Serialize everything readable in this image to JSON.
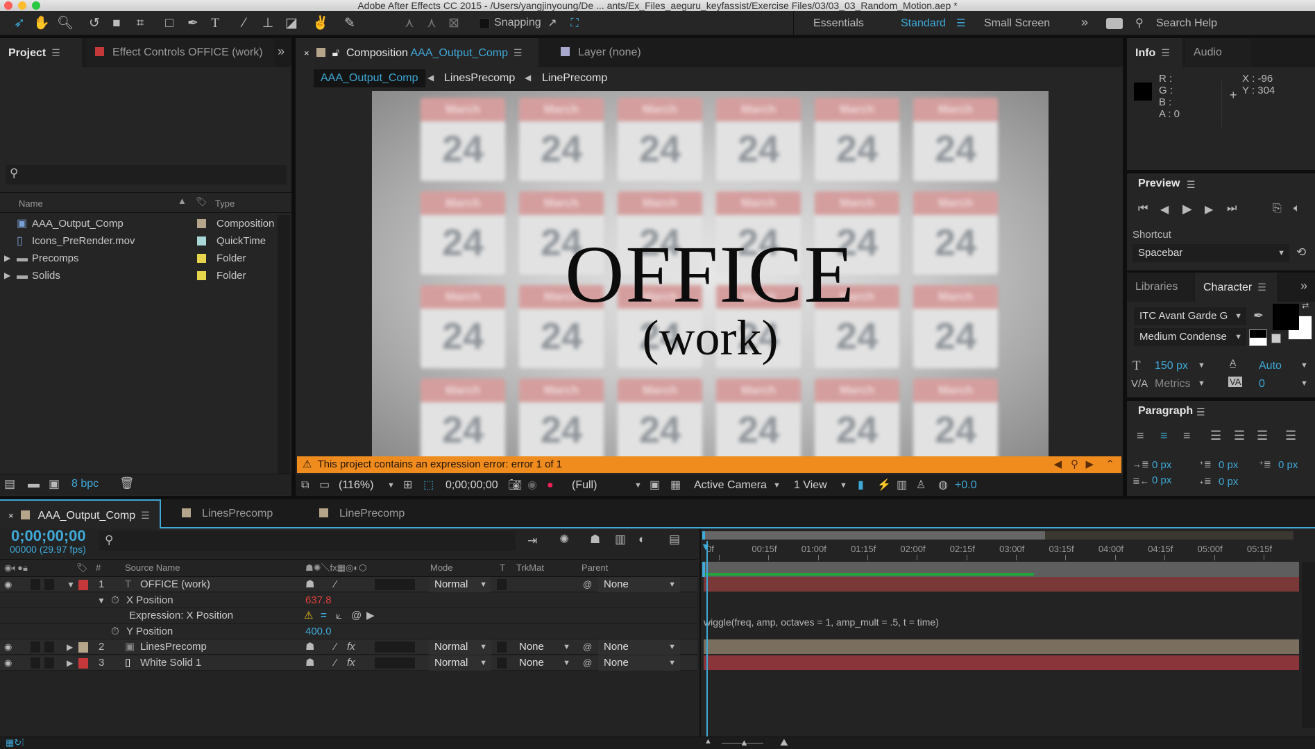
{
  "window": {
    "title": "Adobe After Effects CC 2015 - /Users/yangjinyoung/De ... ants/Ex_Files_aeguru_keyfassist/Exercise Files/03/03_03_Random_Motion.aep *"
  },
  "toolbar": {
    "tools": [
      "selection-tool",
      "hand-tool",
      "zoom-tool",
      "rotation-tool",
      "camera-tool",
      "pan-behind-tool",
      "rectangle-tool",
      "pen-tool",
      "type-tool",
      "brush-tool",
      "clone-stamp-tool",
      "eraser-tool",
      "roto-brush-tool",
      "puppet-pin-tool"
    ],
    "snapping_label": "Snapping",
    "workspaces": [
      "Essentials",
      "Standard",
      "Small Screen"
    ],
    "active_workspace": "Standard",
    "search_placeholder": "Search Help"
  },
  "project_panel": {
    "tab_project": "Project",
    "tab_effect_controls": "Effect Controls OFFICE (work)",
    "search_placeholder": "",
    "columns": {
      "name": "Name",
      "type": "Type"
    },
    "items": [
      {
        "name": "AAA_Output_Comp",
        "type": "Composition",
        "label_color": "#b5a58a",
        "icon": "composition-icon"
      },
      {
        "name": "Icons_PreRender.mov",
        "type": "QuickTime",
        "label_color": "#a9d7d8",
        "icon": "footage-icon"
      },
      {
        "name": "Precomps",
        "type": "Folder",
        "label_color": "#e7d64c",
        "icon": "folder-icon"
      },
      {
        "name": "Solids",
        "type": "Folder",
        "label_color": "#e7d64c",
        "icon": "folder-icon"
      }
    ],
    "bpc": "8 bpc"
  },
  "composition_panel": {
    "tab_prefix": "Composition",
    "tab_comp_name": "AAA_Output_Comp",
    "tab_layer": "Layer (none)",
    "breadcrumbs": [
      "AAA_Output_Comp",
      "LinesPrecomp",
      "LinePrecomp"
    ],
    "viewer": {
      "tile_month": "March",
      "tile_day": "24",
      "headline": "OFFICE",
      "subline": "(work)"
    },
    "error_banner": "This project contains an expression error: error 1 of 1",
    "footer": {
      "zoom": "(116%)",
      "timecode": "0;00;00;00",
      "resolution": "(Full)",
      "camera": "Active Camera",
      "views": "1 View",
      "exposure": "+0.0"
    }
  },
  "info_panel": {
    "tab_info": "Info",
    "tab_audio": "Audio",
    "r": "R :",
    "g": "G :",
    "b": "B :",
    "a": "A : 0",
    "x": "X : -96",
    "y": "Y : 304"
  },
  "preview_panel": {
    "title": "Preview",
    "shortcut_label": "Shortcut",
    "shortcut_value": "Spacebar"
  },
  "character_panel": {
    "tab_libraries": "Libraries",
    "tab_character": "Character",
    "font_family": "ITC Avant Garde G",
    "font_style": "Medium Condense",
    "font_size": "150 px",
    "leading": "Auto",
    "kerning": "Metrics",
    "tracking": "0"
  },
  "paragraph_panel": {
    "title": "Paragraph",
    "indent_left": "0 px",
    "indent_right": "0 px",
    "first_line": "0 px",
    "space_before": "0 px",
    "space_after": "0 px"
  },
  "timeline": {
    "tabs": [
      {
        "label": "AAA_Output_Comp",
        "color": "#b5a58a",
        "active": true
      },
      {
        "label": "LinesPrecomp",
        "color": "#b5a58a",
        "active": false
      },
      {
        "label": "LinePrecomp",
        "color": "#b5a58a",
        "active": false
      }
    ],
    "current_time": "0;00;00;00",
    "frame_info": "00000 (29.97 fps)",
    "columns": {
      "source_name": "Source Name",
      "mode": "Mode",
      "t": "T",
      "trkmat": "TrkMat",
      "parent": "Parent",
      "num": "#"
    },
    "ruler": [
      "0f",
      "00:15f",
      "01:00f",
      "01:15f",
      "02:00f",
      "02:15f",
      "03:00f",
      "03:15f",
      "04:00f",
      "04:15f",
      "05:00f",
      "05:15f"
    ],
    "work_area_end_fraction": 0.58,
    "layers": [
      {
        "num": "1",
        "name": "OFFICE (work)",
        "label_color": "#c4383a",
        "type": "text",
        "mode": "Normal",
        "trkmat": "",
        "parent": "None",
        "bar_color": "#7a3839"
      },
      {
        "num": "2",
        "name": "LinesPrecomp",
        "label_color": "#b5a58a",
        "type": "precomp",
        "mode": "Normal",
        "trkmat": "None",
        "parent": "None",
        "bar_color": "#7a6f5e"
      },
      {
        "num": "3",
        "name": "White Solid 1",
        "label_color": "#c4383a",
        "type": "solid",
        "mode": "Normal",
        "trkmat": "None",
        "parent": "None",
        "bar_color": "#8a3539"
      }
    ],
    "properties": {
      "x_position_label": "X Position",
      "x_position_value": "637.8",
      "expression_label": "Expression: X Position",
      "expression_text": "wiggle(freq, amp, octaves = 1, amp_mult = .5, t = time)",
      "y_position_label": "Y Position",
      "y_position_value": "400.0"
    }
  },
  "colors": {
    "accent": "#3fa9d8",
    "error_banner": "#f08c1e",
    "error_value": "#e0413d"
  }
}
